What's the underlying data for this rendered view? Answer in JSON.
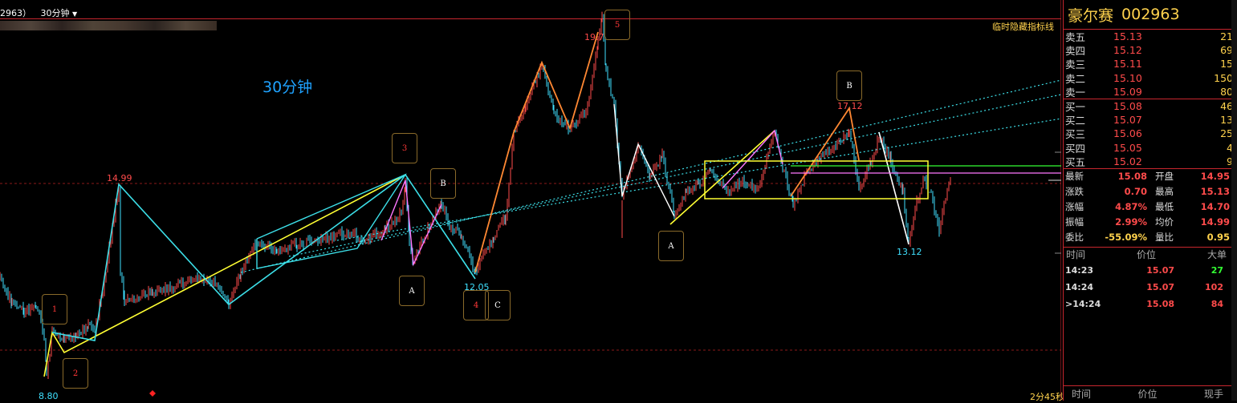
{
  "topbar": {
    "code_fragment": "2963）",
    "period": "30分钟",
    "dropdown_glyph": "▼"
  },
  "hide_indicator_button": "临时隐藏指标线",
  "period_label": "30分钟",
  "timer": "2分45秒",
  "price_labels": {
    "high_1": "14.99",
    "low_start": "8.80",
    "peak": "19.7",
    "low_1205": "12.05",
    "b_1712": "17.12",
    "low_1312": "13.12"
  },
  "markers": {
    "m1": "1",
    "m2": "2",
    "m3": "3",
    "m4": "4",
    "m5": "5",
    "a1": "A",
    "b1": "B",
    "c1": "C",
    "a2": "A",
    "b2": "B"
  },
  "colors": {
    "accent_red": "#c8262e",
    "up": "#ff4b4b",
    "down": "#3fe1ff",
    "gold": "#ffd24d",
    "yellow_line": "#ffff33",
    "cyan_line": "#3cdfe8",
    "pink_line": "#ff77ff"
  },
  "panel": {
    "name": "豪尔赛",
    "code": "002963",
    "sells": [
      {
        "label": "卖五",
        "price": "15.13",
        "vol": "21"
      },
      {
        "label": "卖四",
        "price": "15.12",
        "vol": "69"
      },
      {
        "label": "卖三",
        "price": "15.11",
        "vol": "15"
      },
      {
        "label": "卖二",
        "price": "15.10",
        "vol": "150"
      },
      {
        "label": "卖一",
        "price": "15.09",
        "vol": "80"
      }
    ],
    "buys": [
      {
        "label": "买一",
        "price": "15.08",
        "vol": "46"
      },
      {
        "label": "买二",
        "price": "15.07",
        "vol": "13"
      },
      {
        "label": "买三",
        "price": "15.06",
        "vol": "25"
      },
      {
        "label": "买四",
        "price": "15.05",
        "vol": "4"
      },
      {
        "label": "买五",
        "price": "15.02",
        "vol": "9"
      }
    ],
    "quotes": [
      {
        "l1": "最新",
        "v1": "15.08",
        "l2": "开盘",
        "v2": "14.95"
      },
      {
        "l1": "涨跌",
        "v1": "0.70",
        "l2": "最高",
        "v2": "15.13"
      },
      {
        "l1": "涨幅",
        "v1": "4.87%",
        "l2": "最低",
        "v2": "14.70"
      },
      {
        "l1": "振幅",
        "v1": "2.99%",
        "l2": "均价",
        "v2": "14.99"
      },
      {
        "l1": "委比",
        "v1": "-55.09%",
        "l2": "量比",
        "v2": "0.95"
      }
    ],
    "tick_header": {
      "time": "时间",
      "price": "价位",
      "big": "大单"
    },
    "ticks": [
      {
        "time": "14:23",
        "price": "15.07",
        "vol": "27",
        "color": "#33ff33"
      },
      {
        "time": "14:24",
        "price": "15.07",
        "vol": "102",
        "color": "#ff4b4b"
      },
      {
        "time": ">14:24",
        "price": "15.08",
        "vol": "84",
        "color": "#ff4b4b"
      }
    ],
    "bottom_header": {
      "time": "时间",
      "price": "价位",
      "hand": "现手"
    }
  }
}
